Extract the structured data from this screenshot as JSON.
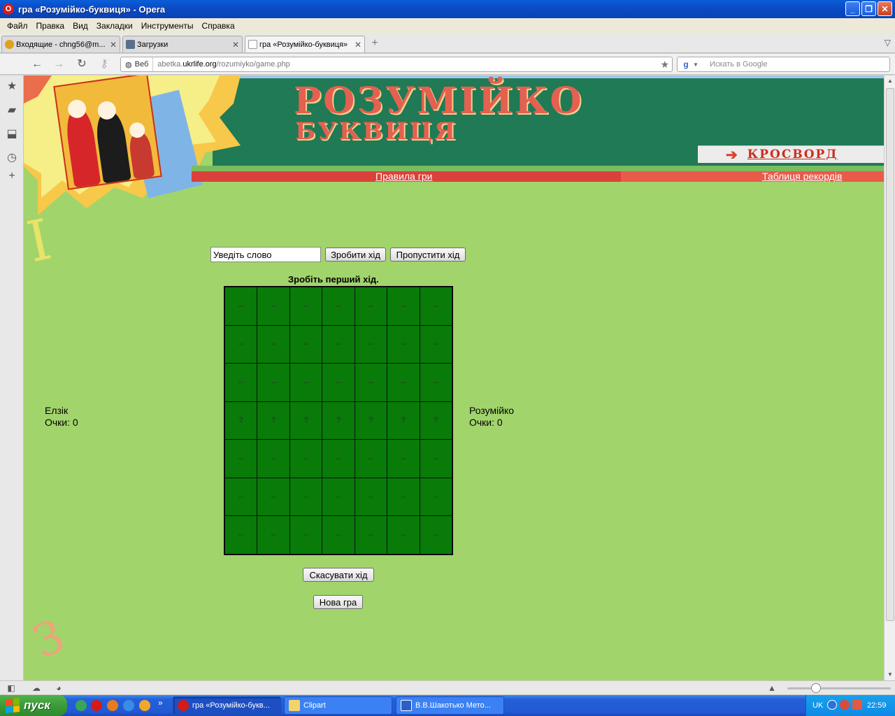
{
  "window": {
    "title": "гра «Розумійко-буквиця» - Opera",
    "app_icon": "O"
  },
  "menu": [
    "Файл",
    "Правка",
    "Вид",
    "Закладки",
    "Инструменты",
    "Справка"
  ],
  "tabs": [
    {
      "label": "Входящие - chng56@m...",
      "icon": "mail-icon"
    },
    {
      "label": "Загрузки",
      "icon": "downloads-icon"
    },
    {
      "label": "гра «Розумійко-буквиця»",
      "icon": "page-icon",
      "active": true
    }
  ],
  "address": {
    "badge": "Веб",
    "url_prefix": "abetka.",
    "url_domain": "ukrlife.org",
    "url_path": "/rozumiyko/game.php"
  },
  "search": {
    "placeholder": "Искать в Google"
  },
  "page": {
    "title": "РОЗУМІЙКО",
    "subtitle": "БУКВИЦЯ",
    "crossword_link": "КРОСВОРД",
    "rules_link": "Правила гри",
    "records_link": "Таблиця рекордів",
    "word_input_value": "Уведіть слово",
    "make_move_button": "Зробити хід",
    "skip_move_button": "Пропустити хід",
    "status": "Зробіть перший хід.",
    "undo_button": "Скасувати хід",
    "new_game_button": "Нова гра",
    "decor_letter_1": "І",
    "decor_letter_2": "З",
    "board": [
      [
        "--",
        "--",
        "--",
        "--",
        "--",
        "--",
        "--"
      ],
      [
        "--",
        "--",
        "--",
        "--",
        "--",
        "--",
        "--"
      ],
      [
        "--",
        "--",
        "--",
        "--",
        "--",
        "--",
        "--"
      ],
      [
        "?",
        "?",
        "?",
        "?",
        "?",
        "?",
        "?"
      ],
      [
        "--",
        "--",
        "--",
        "--",
        "--",
        "--",
        "--"
      ],
      [
        "--",
        "--",
        "--",
        "--",
        "--",
        "--",
        "--"
      ],
      [
        "--",
        "--",
        "--",
        "--",
        "--",
        "--",
        "--"
      ]
    ],
    "player_left": {
      "name": "Елзік",
      "score": "Очки: 0"
    },
    "player_right": {
      "name": "Розумійко",
      "score": "Очки: 0"
    }
  },
  "taskbar": {
    "start": "пуск",
    "quicklaunch_more": "»",
    "tasks": [
      {
        "label": "гра «Розумійко-букв...",
        "icon": "opera-icon",
        "active": true
      },
      {
        "label": "Clipart",
        "icon": "folder-icon"
      },
      {
        "label": "В.В.Шакотько Мето...",
        "icon": "word-icon"
      }
    ],
    "language": "UK",
    "clock": "22:59"
  },
  "colors": {
    "page_background": "#a2d46c",
    "header_green": "#1f7a55",
    "title_red": "#e46050",
    "board_cell": "#087b08"
  }
}
